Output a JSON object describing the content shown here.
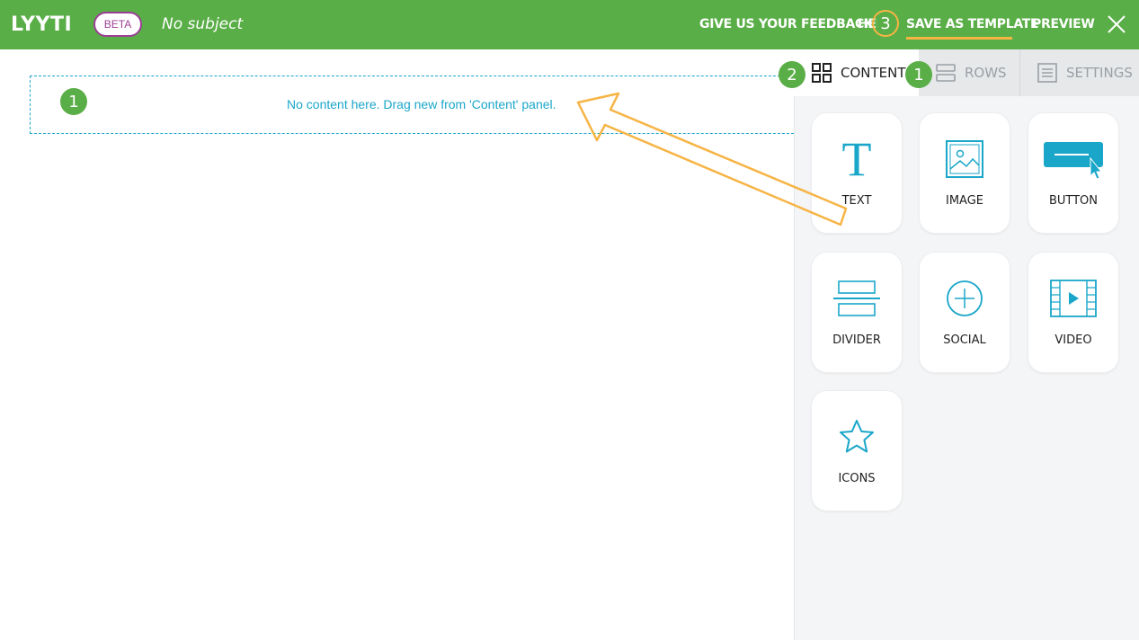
{
  "app": {
    "logo": "LYYTI",
    "beta_label": "BETA",
    "subject": "No subject"
  },
  "nav": {
    "feedback": "GIVE US YOUR FEEDBACK",
    "help": "HELP",
    "save_template": "SAVE AS TEMPLATE",
    "preview": "PREVIEW"
  },
  "badges": {
    "nav_step": "3",
    "panel_content_step": "2",
    "panel_rows_step": "1",
    "canvas_step": "1"
  },
  "canvas": {
    "empty_message": "No content here. Drag new from 'Content' panel."
  },
  "panel": {
    "tabs": [
      {
        "label": "CONTENT",
        "icon": "grid-icon"
      },
      {
        "label": "ROWS",
        "icon": "rows-icon"
      },
      {
        "label": "SETTINGS",
        "icon": "settings-icon"
      }
    ],
    "tiles": [
      {
        "label": "TEXT",
        "icon": "text-icon"
      },
      {
        "label": "IMAGE",
        "icon": "image-icon"
      },
      {
        "label": "BUTTON",
        "icon": "button-icon"
      },
      {
        "label": "DIVIDER",
        "icon": "divider-icon"
      },
      {
        "label": "SOCIAL",
        "icon": "plus-circle-icon"
      },
      {
        "label": "VIDEO",
        "icon": "video-icon"
      },
      {
        "label": "ICONS",
        "icon": "star-icon"
      }
    ]
  },
  "colors": {
    "topbar": "#5aae47",
    "accent": "#1aa6c9",
    "beta": "#9c3f96",
    "highlight": "#f6b445"
  }
}
